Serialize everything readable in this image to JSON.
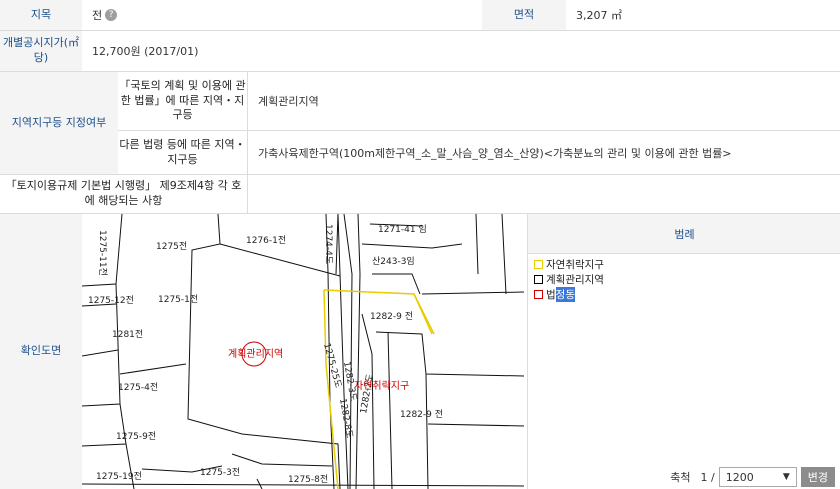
{
  "row1": {
    "label_jimok": "지목",
    "value_jimok": "전",
    "help": "?",
    "label_area": "면적",
    "value_area": "3,207 ㎡"
  },
  "row2": {
    "label_price": "개별공시지가(㎡당)",
    "value_price": "12,700원 (2017/01)"
  },
  "zone": {
    "label": "지역지구등 지정여부",
    "sub1_label": "「국토의 계획 및 이용에 관한 법률」에 따른 지역・지구등",
    "sub1_value": "계획관리지역",
    "sub2_label": "다른 법령 등에 따른 지역・지구등",
    "sub2_value": "가축사육제한구역(100m제한구역_소_말_사슴_양_염소_산양)<가축분뇨의 관리 및 이용에 관한 법률>"
  },
  "row5": {
    "label": "「토지이용규제 기본법 시행령」 제9조제4항 각 호에 해당되는 사항",
    "value": ""
  },
  "map_section": {
    "label": "확인도면"
  },
  "legend": {
    "title": "범례",
    "items": [
      {
        "label": "자연취락지구",
        "color": "#e6cc00"
      },
      {
        "label": "계획관리지역",
        "color": "#000000"
      },
      {
        "label_a": "법",
        "label_b": "정동",
        "color": "#cc0000"
      }
    ]
  },
  "scale": {
    "label": "축척",
    "prefix": "1 /",
    "value": "1200",
    "button": "변경"
  },
  "map_labels": {
    "center": "계획관리지역",
    "center2": "자연취락지구",
    "parcels": [
      "1275-11전",
      "1275전",
      "1276-1전",
      "1274-4도",
      "1271-41 임",
      "산243-3임",
      "1275-12전",
      "1275-1전",
      "1281전",
      "1282-9 전",
      "1275-4전",
      "1275-25도",
      "1282-3도",
      "1282-8도",
      "1282-2도",
      "1282-9 전",
      "1275-9전",
      "1275-3전",
      "1275-19전",
      "1275-8전"
    ]
  },
  "colors": {
    "header_text": "#1c4f8a",
    "header_bg": "#f4f4f4",
    "border": "#dcdcdc"
  }
}
